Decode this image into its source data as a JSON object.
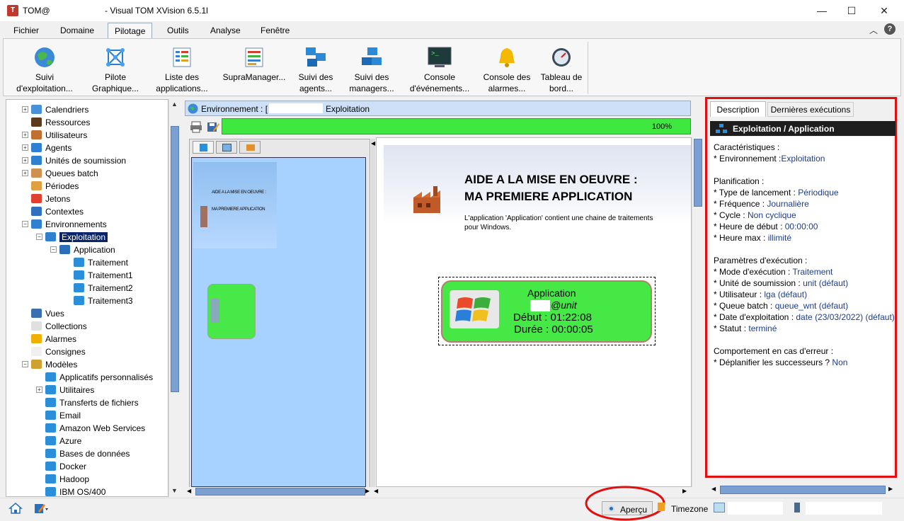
{
  "window": {
    "app_name": "TOM@",
    "title": "- Visual TOM XVision 6.5.1l",
    "minimize": "—",
    "maximize": "☐",
    "close": "✕"
  },
  "menu": [
    "Fichier",
    "Domaine",
    "Pilotage",
    "Outils",
    "Analyse",
    "Fenêtre"
  ],
  "menu_active": "Pilotage",
  "ribbon": [
    {
      "l1": "Suivi",
      "l2": "d'exploitation...",
      "icon": "globe-icon"
    },
    {
      "l1": "Pilote",
      "l2": "Graphique...",
      "icon": "network-graph-icon"
    },
    {
      "l1": "Liste des",
      "l2": "applications...",
      "icon": "list-icon"
    },
    {
      "l1": "SupraManager...",
      "l2": "",
      "icon": "supramanager-icon"
    },
    {
      "l1": "Suivi des",
      "l2": "agents...",
      "icon": "agents-icon"
    },
    {
      "l1": "Suivi des",
      "l2": "managers...",
      "icon": "managers-icon"
    },
    {
      "l1": "Console",
      "l2": "d'événements...",
      "icon": "console-icon"
    },
    {
      "l1": "Console des",
      "l2": "alarmes...",
      "icon": "bell-icon"
    },
    {
      "l1": "Tableau de",
      "l2": "bord...",
      "icon": "gauge-icon"
    }
  ],
  "tree": [
    {
      "label": "Calendriers",
      "level": 1,
      "expander": "+",
      "color": "#4a90d9"
    },
    {
      "label": "Ressources",
      "level": 1,
      "expander": "",
      "color": "#5b3a1d"
    },
    {
      "label": "Utilisateurs",
      "level": 1,
      "expander": "+",
      "color": "#c07030"
    },
    {
      "label": "Agents",
      "level": 1,
      "expander": "+",
      "color": "#2f80d0"
    },
    {
      "label": "Unités de soumission",
      "level": 1,
      "expander": "+",
      "color": "#2f80d0"
    },
    {
      "label": "Queues batch",
      "level": 1,
      "expander": "+",
      "color": "#d09050"
    },
    {
      "label": "Périodes",
      "level": 1,
      "expander": "",
      "color": "#e0a040"
    },
    {
      "label": "Jetons",
      "level": 1,
      "expander": "",
      "color": "#e04030"
    },
    {
      "label": "Contextes",
      "level": 1,
      "expander": "",
      "color": "#3070c0"
    },
    {
      "label": "Environnements",
      "level": 1,
      "expander": "−",
      "color": "#3080d0"
    },
    {
      "label": "Exploitation",
      "level": 2,
      "expander": "−",
      "color": "#3080d0",
      "selected": true
    },
    {
      "label": "Application",
      "level": 3,
      "expander": "−",
      "color": "#2a6fb8"
    },
    {
      "label": "Traitement",
      "level": 4,
      "expander": "",
      "color": "#2a8fd8"
    },
    {
      "label": "Traitement1",
      "level": 4,
      "expander": "",
      "color": "#2a8fd8"
    },
    {
      "label": "Traitement2",
      "level": 4,
      "expander": "",
      "color": "#2a8fd8"
    },
    {
      "label": "Traitement3",
      "level": 4,
      "expander": "",
      "color": "#2a8fd8"
    },
    {
      "label": "Vues",
      "level": 1,
      "expander": "",
      "color": "#3a70b0"
    },
    {
      "label": "Collections",
      "level": 1,
      "expander": "",
      "color": "#e0e0e0"
    },
    {
      "label": "Alarmes",
      "level": 1,
      "expander": "",
      "color": "#f0b000"
    },
    {
      "label": "Consignes",
      "level": 1,
      "expander": "",
      "color": "#f0f0f0"
    },
    {
      "label": "Modèles",
      "level": 1,
      "expander": "−",
      "color": "#d0a030"
    },
    {
      "label": "Applicatifs personnalisés",
      "level": 2,
      "expander": "",
      "color": "#2a8fd8"
    },
    {
      "label": "Utilitaires",
      "level": 2,
      "expander": "+",
      "color": "#2a8fd8"
    },
    {
      "label": "Transferts de fichiers",
      "level": 2,
      "expander": "",
      "color": "#2a8fd8"
    },
    {
      "label": "Email",
      "level": 2,
      "expander": "",
      "color": "#2a8fd8"
    },
    {
      "label": "Amazon Web Services",
      "level": 2,
      "expander": "",
      "color": "#2a8fd8"
    },
    {
      "label": "Azure",
      "level": 2,
      "expander": "",
      "color": "#2a8fd8"
    },
    {
      "label": "Bases de données",
      "level": 2,
      "expander": "",
      "color": "#2a8fd8"
    },
    {
      "label": "Docker",
      "level": 2,
      "expander": "",
      "color": "#2a8fd8"
    },
    {
      "label": "Hadoop",
      "level": 2,
      "expander": "",
      "color": "#2a8fd8"
    },
    {
      "label": "IBM OS/400",
      "level": 2,
      "expander": "",
      "color": "#2a8fd8"
    }
  ],
  "env": {
    "prefix": "Environnement : [",
    "name": "Exploitation"
  },
  "progress": {
    "value": 1.0,
    "label": "100%"
  },
  "doc": {
    "title1": "AIDE A LA MISE EN OEUVRE :",
    "title2": "MA PREMIERE APPLICATION",
    "desc1": "L'application 'Application' contient une chaine de traitements",
    "desc2": "pour Windows."
  },
  "app_node": {
    "name": "Application",
    "user": "@unit",
    "debut": "Début : 01:22:08",
    "duree": "Durée : 00:00:05"
  },
  "thumb_text": {
    "t1": "AIDE A LA MISE EN OEUVRE :",
    "t2": "MA PREMIERE APPLICATION"
  },
  "right": {
    "tabs": [
      "Description",
      "Dernières exécutions"
    ],
    "header": "Exploitation / Application",
    "lines": [
      {
        "k": "Caractéristiques :",
        "v": ""
      },
      {
        "k": "* Environnement :",
        "v": "Exploitation"
      },
      {
        "k": "",
        "v": ""
      },
      {
        "k": "Planification :",
        "v": ""
      },
      {
        "k": "* Type de lancement : ",
        "v": "Périodique"
      },
      {
        "k": "* Fréquence : ",
        "v": "Journalière"
      },
      {
        "k": "* Cycle : ",
        "v": "Non cyclique"
      },
      {
        "k": "* Heure de début : ",
        "v": "00:00:00"
      },
      {
        "k": "* Heure max : ",
        "v": "illimité"
      },
      {
        "k": "",
        "v": ""
      },
      {
        "k": "Paramètres d'exécution :",
        "v": ""
      },
      {
        "k": "* Mode d'exécution : ",
        "v": "Traitement"
      },
      {
        "k": "* Unité de soumission : ",
        "v": "unit (défaut)"
      },
      {
        "k": "* Utilisateur : ",
        "v": "lga (défaut)"
      },
      {
        "k": "* Queue batch : ",
        "v": "queue_wnt (défaut)"
      },
      {
        "k": "* Date d'exploitation : ",
        "v": "date (23/03/2022) (défaut)"
      },
      {
        "k": "* Statut : ",
        "v": "terminé"
      },
      {
        "k": "",
        "v": ""
      },
      {
        "k": "Comportement en cas d'erreur :",
        "v": ""
      },
      {
        "k": "* Déplanifier les successeurs ? ",
        "v": "Non"
      }
    ]
  },
  "status": {
    "apercu": "Aperçu",
    "timezone": "Timezone"
  },
  "colors": {
    "accent_green": "#45e845",
    "highlight_red": "#e01010",
    "selection": "#0a246a"
  }
}
